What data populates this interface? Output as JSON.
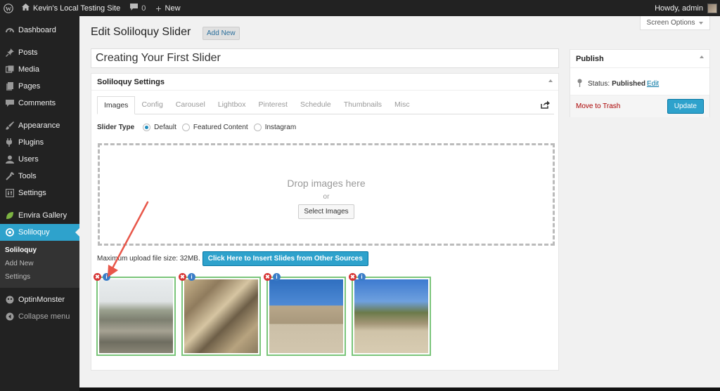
{
  "adminbar": {
    "site_name": "Kevin's Local Testing Site",
    "comments_count": "0",
    "new_label": "New",
    "howdy": "Howdy, admin"
  },
  "sidebar": {
    "items": [
      {
        "label": "Dashboard",
        "icon": "dashboard-icon"
      },
      {
        "label": "Posts",
        "icon": "pin-icon"
      },
      {
        "label": "Media",
        "icon": "media-icon"
      },
      {
        "label": "Pages",
        "icon": "pages-icon"
      },
      {
        "label": "Comments",
        "icon": "comments-icon"
      },
      {
        "label": "Appearance",
        "icon": "brush-icon"
      },
      {
        "label": "Plugins",
        "icon": "plugin-icon"
      },
      {
        "label": "Users",
        "icon": "users-icon"
      },
      {
        "label": "Tools",
        "icon": "wrench-icon"
      },
      {
        "label": "Settings",
        "icon": "settings-icon"
      },
      {
        "label": "Envira Gallery",
        "icon": "leaf-icon"
      },
      {
        "label": "Soliloquy",
        "icon": "soliloquy-icon"
      }
    ],
    "submenu": [
      "Soliloquy",
      "Add New",
      "Settings"
    ],
    "after": [
      {
        "label": "OptinMonster",
        "icon": "optinmonster-icon"
      },
      {
        "label": "Collapse menu",
        "icon": "collapse-icon"
      }
    ]
  },
  "header": {
    "title": "Edit Soliloquy Slider",
    "add_new": "Add New",
    "screen_options": "Screen Options"
  },
  "post_title": "Creating Your First Slider",
  "settings": {
    "heading": "Soliloquy Settings",
    "tabs": [
      "Images",
      "Config",
      "Carousel",
      "Lightbox",
      "Pinterest",
      "Schedule",
      "Thumbnails",
      "Misc"
    ],
    "slider_type_label": "Slider Type",
    "slider_types": [
      "Default",
      "Featured Content",
      "Instagram"
    ],
    "selected_type": "Default",
    "drop_text": "Drop images here",
    "or": "or",
    "select_images": "Select Images",
    "max_upload": "Maximum upload file size: 32MB.",
    "insert_button": "Click Here to Insert Slides from Other Sources"
  },
  "publish": {
    "heading": "Publish",
    "status_label": "Status:",
    "status_value": "Published",
    "status_edit": "Edit",
    "trash": "Move to Trash",
    "update": "Update"
  },
  "thumb_icons": {
    "delete": "✖",
    "info": "i"
  },
  "colors": {
    "accent": "#2ea2cc",
    "thumb_border": "#7ac57a",
    "annotation": "#e8574a"
  }
}
